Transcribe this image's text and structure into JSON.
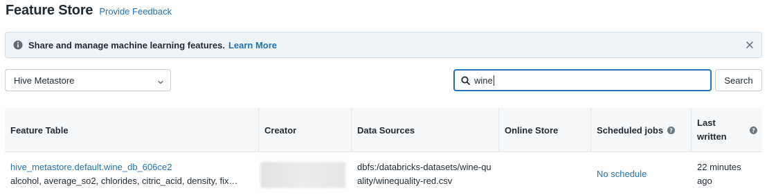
{
  "header": {
    "title": "Feature Store",
    "feedback_link": "Provide Feedback"
  },
  "banner": {
    "icon": "info-icon",
    "text": "Share and manage machine learning features.",
    "link": "Learn More",
    "close_icon": "close-icon"
  },
  "catalog_select": {
    "value": "Hive Metastore"
  },
  "search": {
    "value": "wine",
    "button_label": "Search"
  },
  "table": {
    "columns": [
      "Feature Table",
      "Creator",
      "Data Sources",
      "Online Store",
      "Scheduled jobs",
      "Last written"
    ],
    "rows": [
      {
        "feature_table": "hive_metastore.default.wine_db_606ce2",
        "features": "alcohol, average_so2, chlorides, citric_acid, density, fix…",
        "creator": "",
        "data_sources": "dbfs:/databricks-datasets/wine-quality/winequality-red.csv",
        "online_store": "",
        "scheduled_jobs": "No schedule",
        "last_written": "22 minutes ago"
      }
    ]
  },
  "colors": {
    "link": "#2272b4",
    "banner_bg": "#eef3f7",
    "header_bg": "#f7f8f9"
  }
}
